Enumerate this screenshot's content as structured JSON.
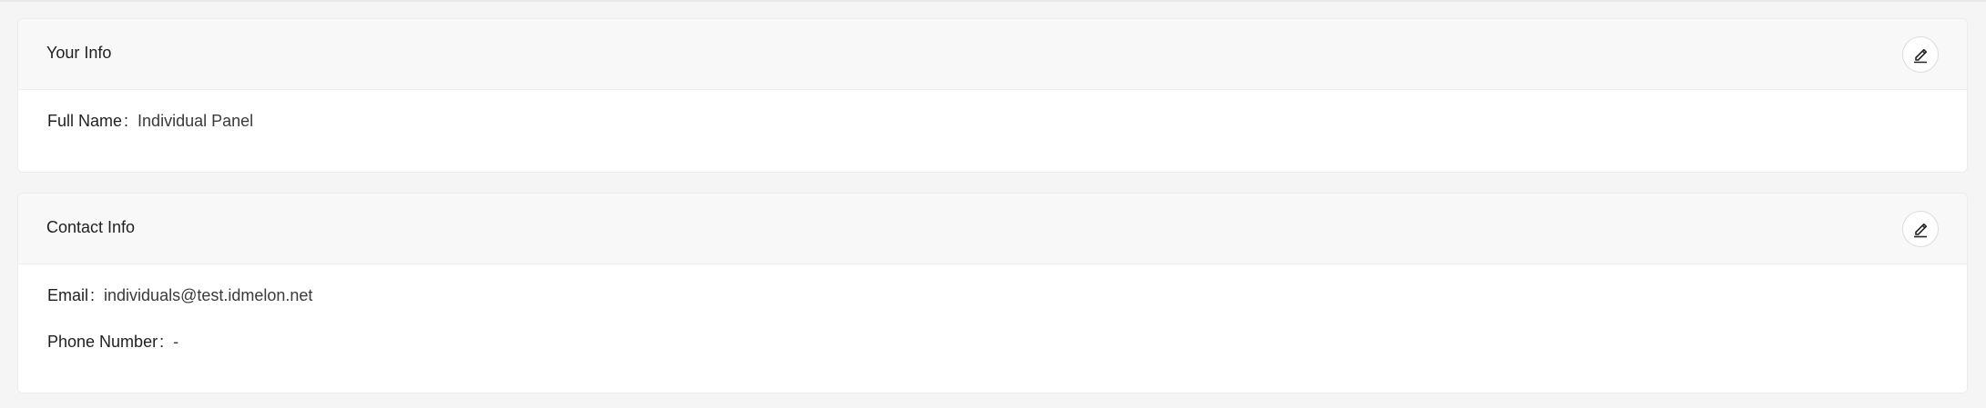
{
  "your_info": {
    "title": "Your Info",
    "fields": [
      {
        "label": "Full Name",
        "value": "Individual Panel"
      }
    ]
  },
  "contact_info": {
    "title": "Contact Info",
    "fields": [
      {
        "label": "Email",
        "value": "individuals@test.idmelon.net"
      },
      {
        "label": "Phone Number",
        "value": "-"
      }
    ]
  },
  "separator": ":",
  "icons": {
    "edit": "pencil-edit-icon"
  }
}
